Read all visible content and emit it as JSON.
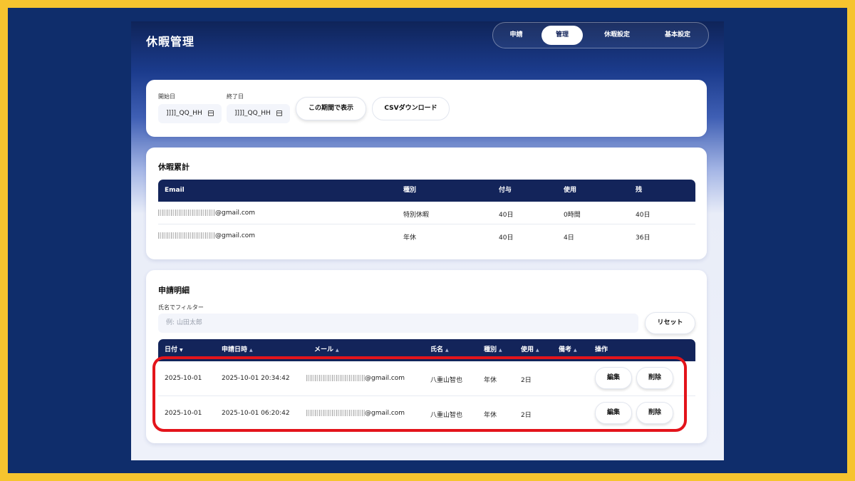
{
  "app": {
    "title": "休暇管理"
  },
  "tabs": [
    {
      "label": "申請"
    },
    {
      "label": "管理"
    },
    {
      "label": "休暇設定"
    },
    {
      "label": "基本設定"
    }
  ],
  "period": {
    "start_label": "開始日",
    "start_value": "]]]]_QQ_HH",
    "end_label": "終了日",
    "end_value": "]]]]_QQ_HH",
    "show_button": "この期間で表示",
    "csv_button": "CSVダウンロード"
  },
  "summary": {
    "title": "休暇累計",
    "headers": [
      "Email",
      "種別",
      "付与",
      "使用",
      "残"
    ],
    "rows": [
      {
        "email": "@gmail.com",
        "type": "特別休暇",
        "granted": "40日",
        "used": "0時間",
        "remaining": "40日"
      },
      {
        "email": "@gmail.com",
        "type": "年休",
        "granted": "40日",
        "used": "4日",
        "remaining": "36日"
      }
    ]
  },
  "details": {
    "title": "申請明細",
    "filter_label": "氏名でフィルター",
    "filter_placeholder": "例: 山田太郎",
    "reset_button": "リセット",
    "headers": [
      "日付",
      "申請日時",
      "メール",
      "氏名",
      "種別",
      "使用",
      "備考",
      "操作"
    ],
    "sort_desc": "▼",
    "sort_asc": "▲",
    "rows": [
      {
        "date": "2025-10-01",
        "applied_at": "2025-10-01 20:34:42",
        "email": "@gmail.com",
        "name": "八重山智也",
        "type": "年休",
        "used": "2日",
        "edit": "編集",
        "delete": "削除"
      },
      {
        "date": "2025-10-01",
        "applied_at": "2025-10-01 06:20:42",
        "email": "@gmail.com",
        "name": "八重山智也",
        "type": "年休",
        "used": "2日",
        "edit": "編集",
        "delete": "削除"
      }
    ]
  },
  "colors": {
    "frame": "#f6c42f",
    "background": "#0f2d6b",
    "table_header": "#13245a",
    "highlight": "#e3141b"
  }
}
